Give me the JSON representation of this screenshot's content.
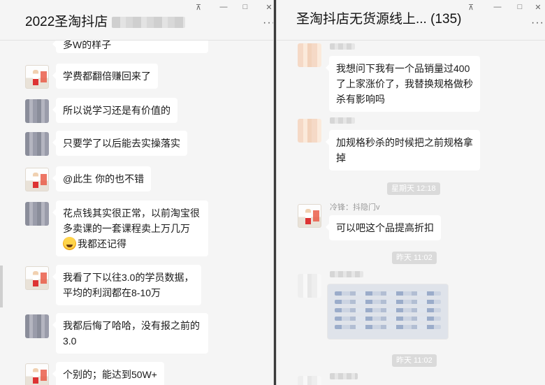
{
  "left_window": {
    "title": "2022圣淘抖店",
    "controls": {
      "pin": "⊼",
      "minimize": "—",
      "maximize": "□",
      "close": "✕"
    },
    "more": "···",
    "messages": [
      {
        "avatar": "logo",
        "text": "学费都翻倍赚回来了"
      },
      {
        "avatar": "gray",
        "text": "所以说学习还是有价值的"
      },
      {
        "avatar": "gray",
        "text": "只要学了以后能去实操落实"
      },
      {
        "avatar": "logo",
        "text": "@此生 你的也不错"
      },
      {
        "avatar": "gray",
        "line1": "花点钱其实很正常，以前淘宝很",
        "line2": "多卖课的一套课程卖上万几万",
        "line3": "我都还记得"
      },
      {
        "avatar": "logo",
        "line1": "我看了下以往3.0的学员数据，",
        "line2": "平均的利润都在8-10万"
      },
      {
        "avatar": "gray",
        "line1": "我都后悔了哈哈，没有报之前的",
        "line2": "3.0"
      },
      {
        "avatar": "logo",
        "text": "个别的；能达到50W+"
      }
    ],
    "cut_off_text": "多W的样子"
  },
  "right_window": {
    "title": "圣淘抖店无货源线上... (135)",
    "controls": {
      "pin": "⊼",
      "minimize": "—",
      "maximize": "□",
      "close": "✕"
    },
    "more": "···",
    "messages": [
      {
        "avatar": "peach",
        "line1": "我想问下我有一个品销量过400",
        "line2": "了上家涨价了，我替换规格做秒",
        "line3": "杀有影响吗"
      },
      {
        "avatar": "peach",
        "line1": "加规格秒杀的时候把之前规格拿",
        "line2": "掉"
      },
      {
        "avatar": "logo",
        "sender": "冷锋：抖隐门v",
        "text": "可以吧这个品提高折扣"
      },
      {
        "avatar": "white",
        "type": "image"
      }
    ],
    "timestamps": [
      "星期天 12:18",
      "昨天 11:02",
      "昨天 11:02"
    ]
  }
}
